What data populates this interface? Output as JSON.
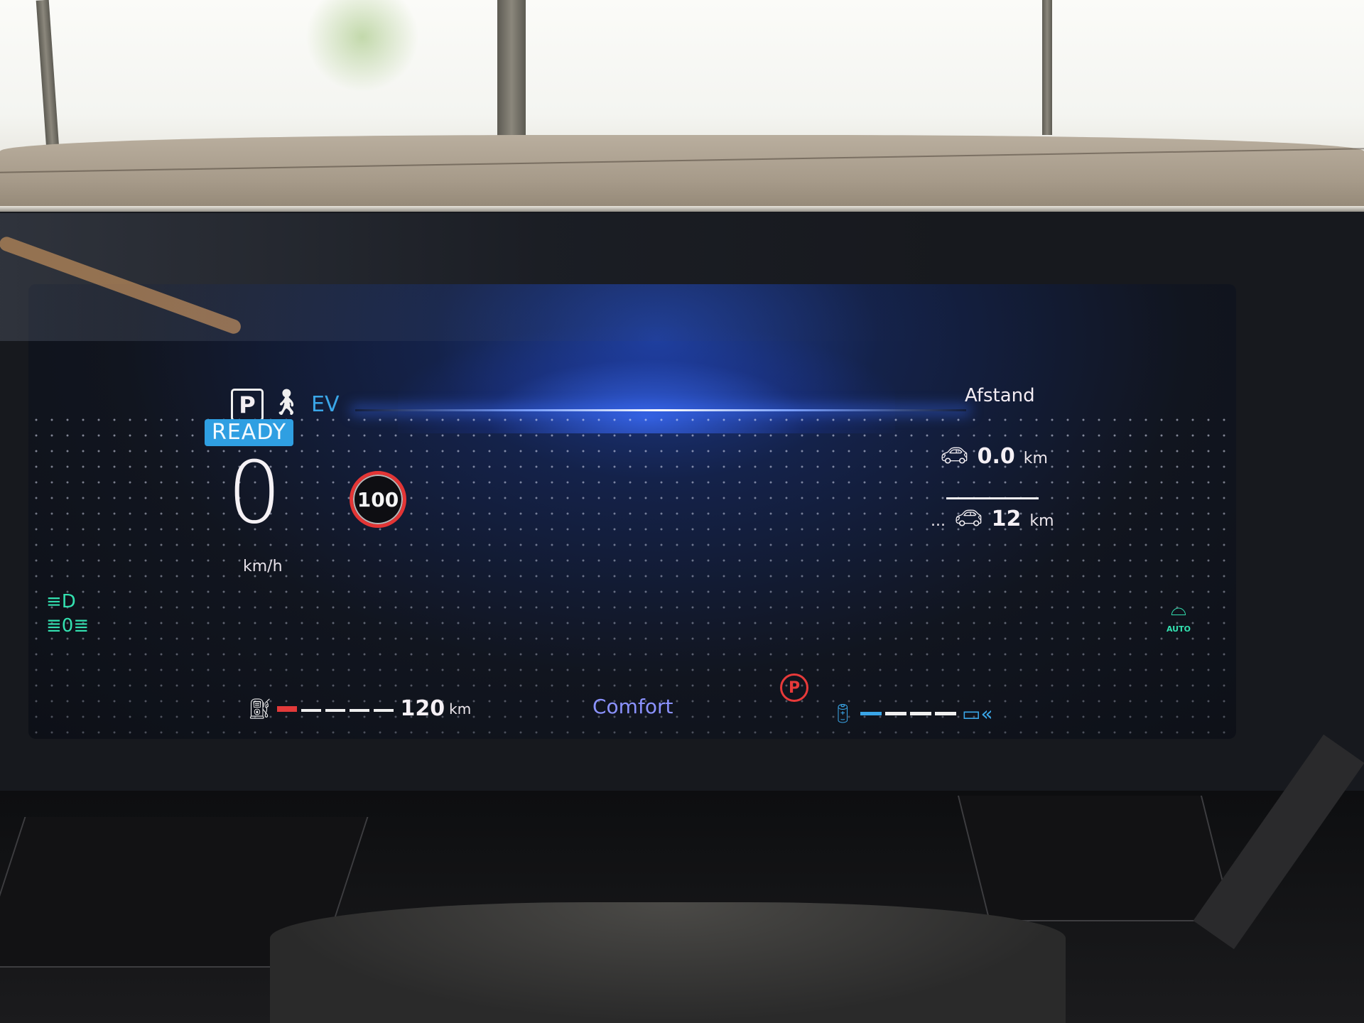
{
  "cluster": {
    "gear": "P",
    "drive_mode_indicator": "EV",
    "status_badge": "READY",
    "speed": {
      "value": "0",
      "unit": "km/h"
    },
    "speed_limit_sign": "100",
    "distance_panel": {
      "title": "Afstand",
      "trip_distance": {
        "value": "0.0",
        "unit": "km"
      },
      "range_distance": {
        "prefix": "...",
        "value": "12",
        "unit": "km"
      }
    },
    "fuel": {
      "range_value": "120",
      "range_unit": "km",
      "level_fraction": 0.1
    },
    "driving_mode": "Comfort",
    "battery": {
      "charge_fraction": 0.25
    },
    "icons": {
      "gear": "parking-gear-icon",
      "driver": "driver-seatbelt-icon",
      "headlight": "high-beam-icon",
      "fog_light": "position-lights-icon",
      "wiper": "auto-wiper-icon",
      "wiper_label": "AUTO",
      "fuel": "fuel-pump-icon",
      "parking_brake": "electric-parking-brake-icon",
      "hybrid_battery": "hybrid-battery-icon",
      "regen": "battery-regen-icon"
    },
    "colors": {
      "ready_badge": "#2f9fe2",
      "ev_text": "#3aa6e8",
      "speed_limit_ring": "#e43535",
      "parking_brake": "#e83a3a",
      "indicator_green": "#33e0b0",
      "mode_text": "#8b92ff",
      "fuel_low": "#e23a3a"
    }
  }
}
